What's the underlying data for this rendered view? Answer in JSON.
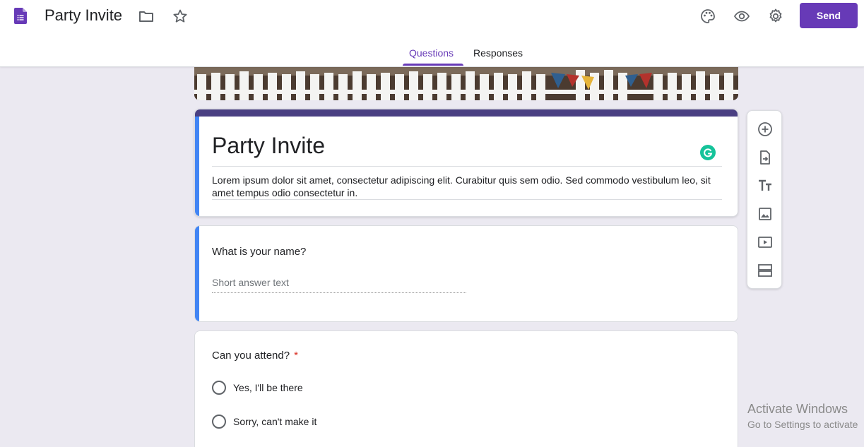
{
  "header": {
    "title": "Party Invite",
    "send_label": "Send",
    "icons": [
      "forms-app-icon",
      "folder-icon",
      "star-icon",
      "palette-icon",
      "eye-icon",
      "gear-icon"
    ],
    "tabs": [
      {
        "label": "Questions",
        "active": true
      },
      {
        "label": "Responses",
        "active": false
      }
    ],
    "accent_color": "#673ab7"
  },
  "form": {
    "title": "Party Invite",
    "description": "Lorem ipsum dolor sit amet, consectetur adipiscing elit. Curabitur quis sem odio. Sed commodo vestibulum leo, sit amet tempus odio consectetur in.",
    "theme_bar_color": "#4a3f82",
    "active_bar_color": "#4285f4"
  },
  "questions": [
    {
      "title": "What is your name?",
      "placeholder": "Short answer text",
      "required": false
    },
    {
      "title": "Can you attend?",
      "required": true,
      "required_mark": "*",
      "options": [
        "Yes,  I'll be there",
        "Sorry, can't make it"
      ]
    }
  ],
  "toolbar": {
    "tools": [
      "add-question-icon",
      "import-questions-icon",
      "add-title-icon",
      "add-image-icon",
      "add-video-icon",
      "add-section-icon"
    ]
  },
  "watermark": {
    "line1": "Activate Windows",
    "line2": "Go to Settings to activate"
  }
}
